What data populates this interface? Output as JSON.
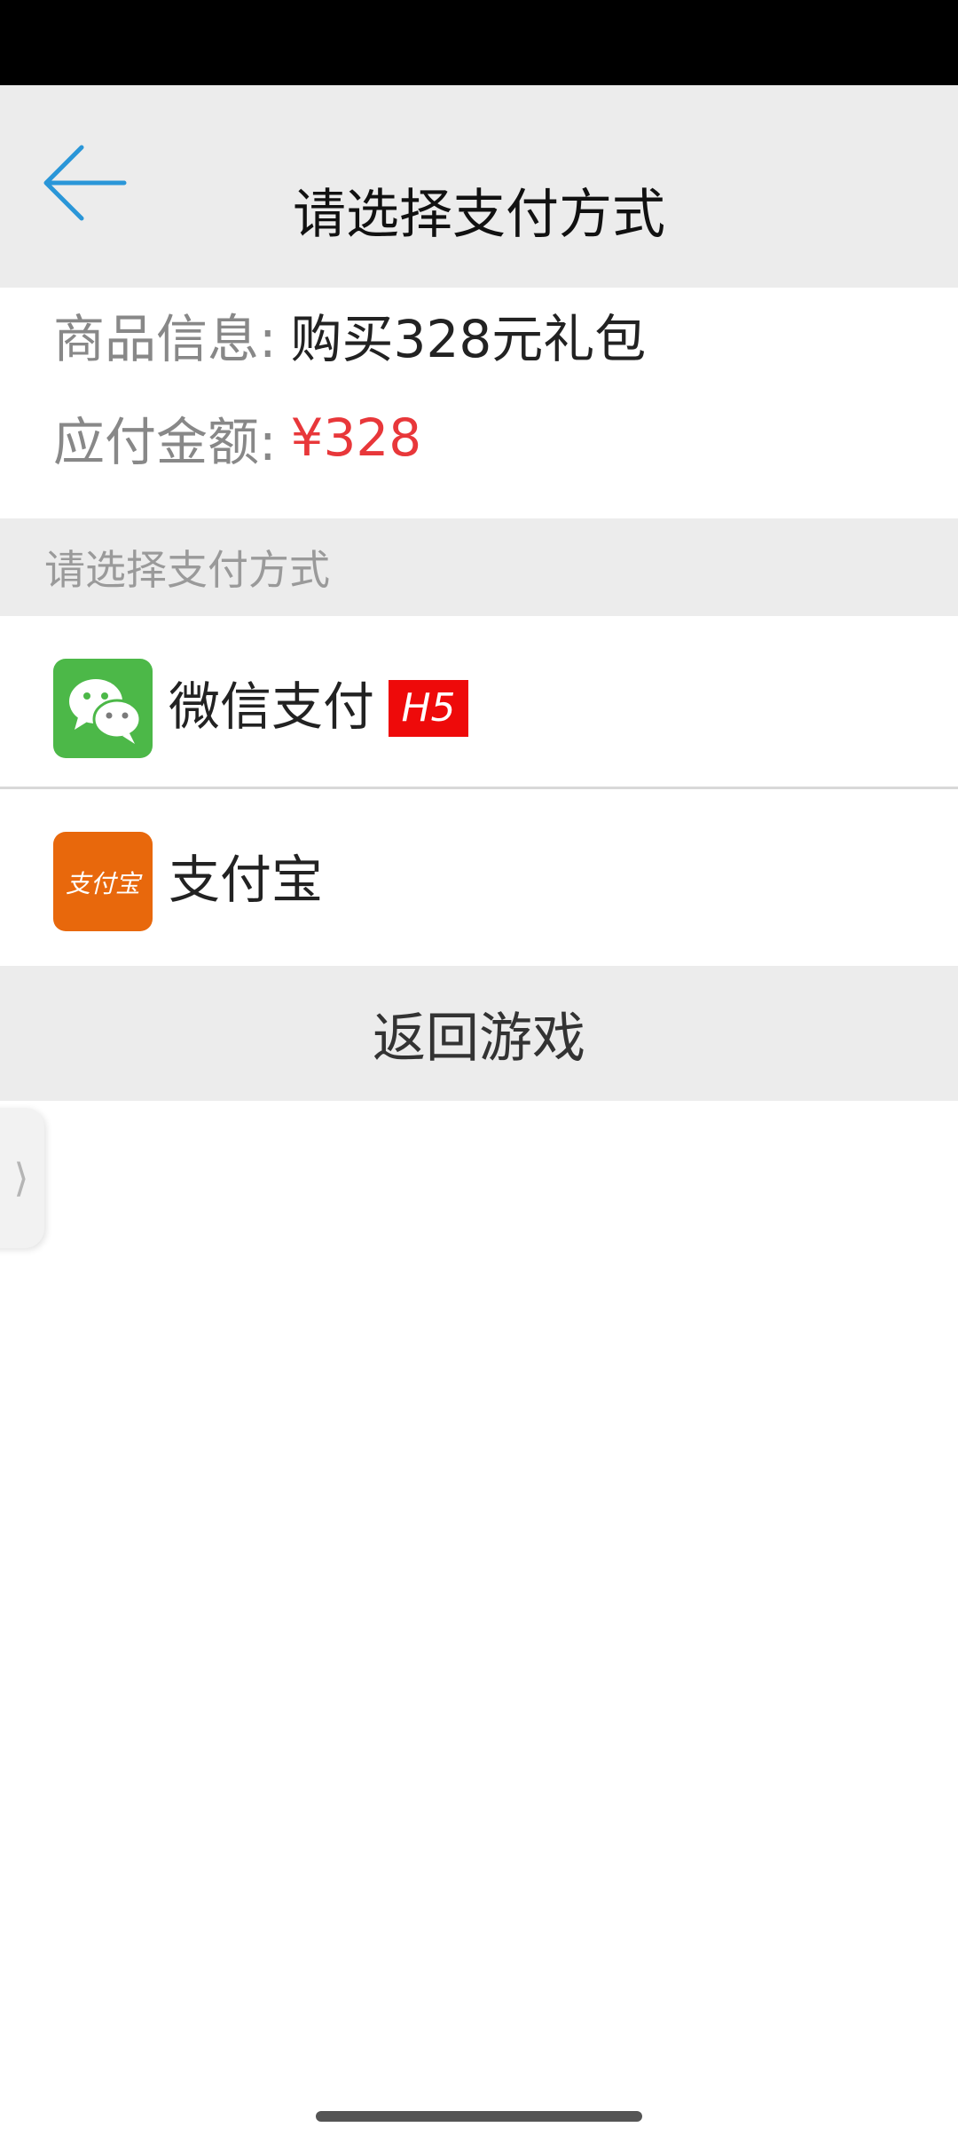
{
  "header": {
    "title": "请选择支付方式",
    "back_icon": "arrow-left-icon"
  },
  "order": {
    "product_label": "商品信息:",
    "product_value": "购买328元礼包",
    "amount_label": "应付金额:",
    "amount_value": "¥328"
  },
  "section": {
    "title": "请选择支付方式"
  },
  "payment_methods": [
    {
      "label": "微信支付",
      "badge": "H5",
      "icon": "wechat-pay-icon"
    },
    {
      "label": "支付宝",
      "icon_text": "支付宝",
      "icon": "alipay-icon"
    }
  ],
  "return_button": {
    "label": "返回游戏"
  },
  "side_tab": {
    "glyph": "⟩"
  },
  "colors": {
    "accent_blue": "#2a96d8",
    "price_red": "#e8373a",
    "wechat_green": "#4cb848",
    "alipay_orange": "#e8680c",
    "badge_red": "#ee0a0a"
  }
}
